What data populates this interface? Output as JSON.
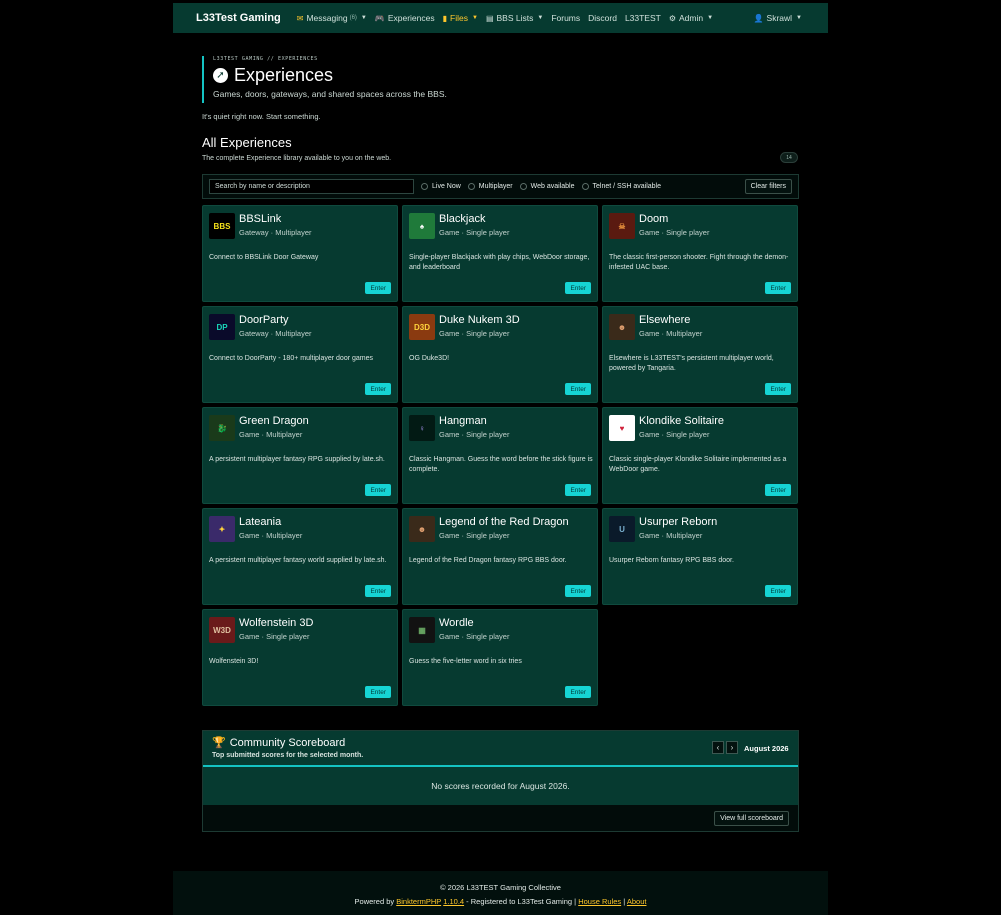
{
  "nav": {
    "brand": "L33Test Gaming",
    "messaging": "Messaging",
    "messaging_count": "(6)",
    "experiences": "Experiences",
    "files": "Files",
    "bbs_lists": "BBS Lists",
    "forums": "Forums",
    "discord": "Discord",
    "l33test": "L33TEST",
    "admin": "Admin",
    "user": "Skrawl"
  },
  "hero": {
    "eyebrow": "L33TEST GAMING // EXPERIENCES",
    "title": "Experiences",
    "subtitle": "Games, doors, gateways, and shared spaces across the BBS."
  },
  "quiet": "It's quiet right now. Start something.",
  "library": {
    "title": "All Experiences",
    "subtitle": "The complete Experience library available to you on the web.",
    "count": "14"
  },
  "filters": {
    "search_placeholder": "Search by name or description",
    "live_now": "Live Now",
    "multiplayer": "Multiplayer",
    "web_available": "Web available",
    "telnet": "Telnet / SSH available",
    "clear": "Clear filters"
  },
  "enter_label": "Enter",
  "cards": [
    {
      "title": "BBSLink",
      "meta": "Gateway · Multiplayer",
      "desc": "Connect to BBSLink Door Gateway",
      "icon": "bbslink-logo",
      "icon_text": "BBS",
      "icon_bg": "#000000",
      "icon_fg": "#f5e21b"
    },
    {
      "title": "Blackjack",
      "meta": "Game · Single player",
      "desc": "Single-player Blackjack with play chips, WebDoor storage, and leaderboard",
      "icon": "playing-card-icon",
      "icon_text": "♠",
      "icon_bg": "#1f7a3a",
      "icon_fg": "#ffffff"
    },
    {
      "title": "Doom",
      "meta": "Game · Single player",
      "desc": "The classic first-person shooter. Fight through the demon-infested UAC base.",
      "icon": "doom-icon",
      "icon_text": "☠",
      "icon_bg": "#5a1a10",
      "icon_fg": "#e08a3a"
    },
    {
      "title": "DoorParty",
      "meta": "Gateway · Multiplayer",
      "desc": "Connect to DoorParty - 180+ multiplayer door games",
      "icon": "doorparty-logo",
      "icon_text": "DP",
      "icon_bg": "#0a0a2a",
      "icon_fg": "#19d6b8"
    },
    {
      "title": "Duke Nukem 3D",
      "meta": "Game · Single player",
      "desc": "OG Duke3D!",
      "icon": "duke-nukem-icon",
      "icon_text": "D3D",
      "icon_bg": "#8a3a10",
      "icon_fg": "#ffd23c"
    },
    {
      "title": "Elsewhere",
      "meta": "Game · Multiplayer",
      "desc": "Elsewhere is L33TEST's persistent multiplayer world, powered by Tangaria.",
      "icon": "character-face-icon",
      "icon_text": "☻",
      "icon_bg": "#3a2a1a",
      "icon_fg": "#e0a070"
    },
    {
      "title": "Green Dragon",
      "meta": "Game · Multiplayer",
      "desc": "A persistent multiplayer fantasy RPG supplied by late.sh.",
      "icon": "dragon-icon",
      "icon_text": "🐉",
      "icon_bg": "#1a3a1a",
      "icon_fg": "#9ad04a"
    },
    {
      "title": "Hangman",
      "meta": "Game · Single player",
      "desc": "Classic Hangman. Guess the word before the stick figure is complete.",
      "icon": "stick-figure-icon",
      "icon_text": "♀",
      "icon_bg": "#021a14",
      "icon_fg": "#b49cff"
    },
    {
      "title": "Klondike Solitaire",
      "meta": "Game · Single player",
      "desc": "Classic single-player Klondike Solitaire implemented as a WebDoor game.",
      "icon": "heart-card-icon",
      "icon_text": "♥",
      "icon_bg": "#ffffff",
      "icon_fg": "#d0203a"
    },
    {
      "title": "Lateania",
      "meta": "Game · Multiplayer",
      "desc": "A persistent multiplayer fantasy world supplied by late.sh.",
      "icon": "wizard-icon",
      "icon_text": "✦",
      "icon_bg": "#3a2a6a",
      "icon_fg": "#ffd23c"
    },
    {
      "title": "Legend of the Red Dragon",
      "meta": "Game · Single player",
      "desc": "Legend of the Red Dragon fantasy RPG BBS door.",
      "icon": "character-face-icon",
      "icon_text": "☻",
      "icon_bg": "#3a2a1a",
      "icon_fg": "#e0a070"
    },
    {
      "title": "Usurper Reborn",
      "meta": "Game · Multiplayer",
      "desc": "Usurper Reborn fantasy RPG BBS door.",
      "icon": "usurper-logo",
      "icon_text": "U",
      "icon_bg": "#0a1a2a",
      "icon_fg": "#7ab0d0"
    },
    {
      "title": "Wolfenstein 3D",
      "meta": "Game · Single player",
      "desc": "Wolfenstein 3D!",
      "icon": "wolfenstein-icon",
      "icon_text": "W3D",
      "icon_bg": "#6a1a1a",
      "icon_fg": "#e0c0a0"
    },
    {
      "title": "Wordle",
      "meta": "Game · Single player",
      "desc": "Guess the five-letter word in six tries",
      "icon": "wordle-grid-icon",
      "icon_text": "▦",
      "icon_bg": "#121212",
      "icon_fg": "#6aaa64"
    }
  ],
  "scoreboard": {
    "title": "Community Scoreboard",
    "subtitle": "Top submitted scores for the selected month.",
    "month": "August 2026",
    "empty": "No scores recorded for August 2026.",
    "view_full": "View full scoreboard"
  },
  "footer": {
    "copyright": "© 2026 L33TEST Gaming Collective",
    "powered_by": "Powered by",
    "software": "BinktermPHP",
    "version": "1.10.4",
    "registered": "- Registered to L33Test Gaming |",
    "house_rules": "House Rules",
    "sep": "|",
    "about": "About"
  },
  "colors": {
    "accent": "#16d4d4",
    "card_bg": "#063a30",
    "highlight": "#ffc72c"
  }
}
